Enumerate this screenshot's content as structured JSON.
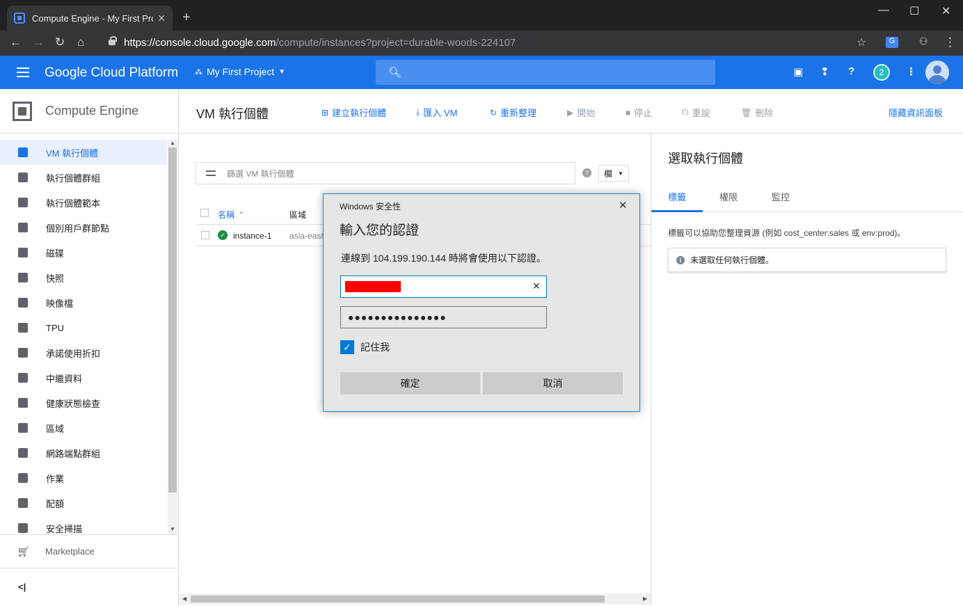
{
  "browser": {
    "tab_title": "Compute Engine - My First Proj",
    "tab_close": "✕",
    "new_tab": "+",
    "url_host": "https://console.cloud.google.com",
    "url_path": "/compute/instances?project=durable-woods-224107",
    "icons": [
      "back-arrow-icon",
      "forward-arrow-icon",
      "reload-icon",
      "home-icon",
      "lock-icon",
      "star-icon",
      "translate-icon",
      "incognito-icon",
      "more-vert-icon"
    ]
  },
  "gcp": {
    "brand": "Google Cloud Platform",
    "project": "My First Project",
    "notifications_count": "2"
  },
  "sidebar": {
    "title": "Compute Engine",
    "items": [
      {
        "label": "VM 執行個體"
      },
      {
        "label": "執行個體群組"
      },
      {
        "label": "執行個體範本"
      },
      {
        "label": "個別用戶群節點"
      },
      {
        "label": "磁碟"
      },
      {
        "label": "快照"
      },
      {
        "label": "映像檔"
      },
      {
        "label": "TPU"
      },
      {
        "label": "承諾使用折扣"
      },
      {
        "label": "中繼資料"
      },
      {
        "label": "健康狀態檢查"
      },
      {
        "label": "區域"
      },
      {
        "label": "網路端點群組"
      },
      {
        "label": "作業"
      },
      {
        "label": "配額"
      },
      {
        "label": "安全掃描"
      }
    ],
    "marketplace": "Marketplace",
    "collapse": "<|"
  },
  "toolbar": {
    "title": "VM 執行個體",
    "create": "建立執行個體",
    "import": "匯入 VM",
    "refresh": "重新整理",
    "start": "開始",
    "stop": "停止",
    "reset": "重設",
    "delete": "刪除",
    "hide_info": "隱藏資訊面板"
  },
  "list": {
    "filter_placeholder": "篩選 VM 執行個體",
    "columns_button": "欄",
    "headers": {
      "name": "名稱",
      "zone": "區域"
    },
    "rows": [
      {
        "name": "instance-1",
        "zone": "asia-east"
      }
    ]
  },
  "info_panel": {
    "title": "選取執行個體",
    "tabs": [
      "標籤",
      "權限",
      "監控"
    ],
    "description": "標籤可以協助您整理資源 (例如 cost_center:sales 或 env:prod)。",
    "notice": "未選取任何執行個體。"
  },
  "dialog": {
    "caption": "Windows 安全性",
    "heading": "輸入您的認證",
    "message": "連線到 104.199.190.144 時將會使用以下認證。",
    "password_mask": "●●●●●●●●●●●●●●●",
    "remember_label": "記住我",
    "remember_checked": true,
    "ok": "確定",
    "cancel": "取消"
  },
  "colors": {
    "gcp_blue": "#1a73e8",
    "chrome_dark": "#202124",
    "dialog_accent": "#0078d7",
    "running_green": "#1e8e3e"
  }
}
